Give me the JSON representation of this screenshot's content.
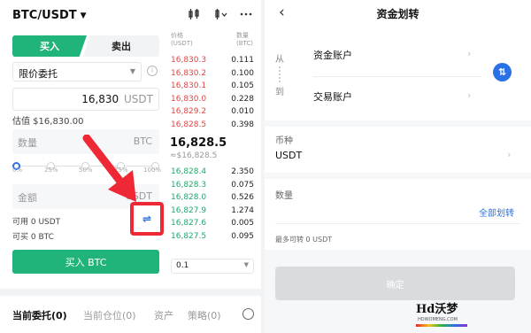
{
  "left": {
    "pair": "BTC/USDT",
    "header_icons": [
      "candlestick-icon",
      "overflow-icon",
      "more-icon"
    ],
    "tabs": {
      "buy": "买入",
      "sell": "卖出"
    },
    "order_type": "限价委托",
    "price_value": "16,830",
    "price_unit": "USDT",
    "estimate": "估值 $16,830.00",
    "quantity_placeholder": "数量",
    "quantity_unit": "BTC",
    "slider_labels": [
      "0%",
      "25%",
      "50%",
      "75%",
      "100%"
    ],
    "slider_value": 0,
    "amount_placeholder": "金额",
    "amount_unit": "USDT",
    "available": "可用 0 USDT",
    "can_buy": "可买 0 BTC",
    "buy_button": "买入 BTC",
    "orderbook": {
      "price_header": "价格\n(USDT)",
      "qty_header": "数量\n(BTC)",
      "asks": [
        {
          "price": "16,830.3",
          "qty": "0.111"
        },
        {
          "price": "16,830.2",
          "qty": "0.100"
        },
        {
          "price": "16,830.1",
          "qty": "0.105"
        },
        {
          "price": "16,830.0",
          "qty": "0.228"
        },
        {
          "price": "16,829.2",
          "qty": "0.010"
        },
        {
          "price": "16,828.5",
          "qty": "0.398"
        }
      ],
      "last_price": "16,828.5",
      "last_fiat": "≈$16,828.5",
      "bids": [
        {
          "price": "16,828.4",
          "qty": "2.350"
        },
        {
          "price": "16,828.3",
          "qty": "0.075"
        },
        {
          "price": "16,828.0",
          "qty": "0.526"
        },
        {
          "price": "16,827.9",
          "qty": "1.274"
        },
        {
          "price": "16,827.6",
          "qty": "0.005"
        },
        {
          "price": "16,827.5",
          "qty": "0.095"
        }
      ],
      "depth": "0.1"
    },
    "bottom_tabs": [
      "当前委托(0)",
      "当前仓位(0)",
      "资产",
      "策略(0)"
    ]
  },
  "right": {
    "title": "资金划转",
    "from_label": "从",
    "from_account": "资金账户",
    "to_label": "到",
    "to_account": "交易账户",
    "coin_label": "币种",
    "coin_value": "USDT",
    "qty_label": "数量",
    "transfer_all": "全部划转",
    "max_transfer": "最多可转 0 USDT",
    "confirm": "确定"
  },
  "watermark": {
    "main": "Hd沃梦",
    "sub": "HDWOMENG.COM"
  },
  "colors": {
    "buy_green": "#21b47a",
    "ask_red": "#e14444",
    "bid_green": "#1ea96e",
    "accent_blue": "#2b71e6",
    "highlight_red": "#ee2935"
  }
}
